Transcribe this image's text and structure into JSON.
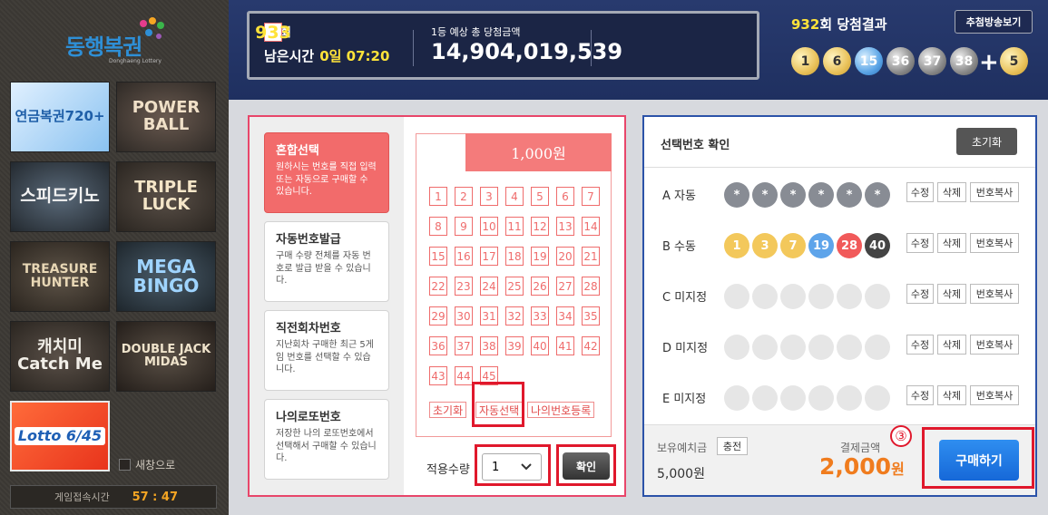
{
  "logo": {
    "text": "동행복권",
    "sub": "Donghaeng Lottery"
  },
  "games": [
    {
      "label": "연금복권720+",
      "icon": "pension-lottery-icon"
    },
    {
      "label": "POWER BALL",
      "icon": "powerball-icon"
    },
    {
      "label": "스피드키노",
      "icon": "speed-keno-icon"
    },
    {
      "label": "TRIPLE LUCK",
      "icon": "triple-luck-icon"
    },
    {
      "label": "TREASURE HUNTER",
      "icon": "treasure-hunter-icon"
    },
    {
      "label": "MEGA BINGO",
      "icon": "mega-bingo-icon"
    },
    {
      "label": "캐치미 Catch Me",
      "icon": "catch-me-icon"
    },
    {
      "label": "DOUBLE JACK MIDAS",
      "icon": "double-jack-icon"
    },
    {
      "label": "Lotto 6/45",
      "icon": "lotto645-icon"
    }
  ],
  "new_window": "새창으로",
  "session": {
    "label": "게임접속시간",
    "value": "57 : 47"
  },
  "draw": {
    "prefix": "제",
    "round": "933",
    "suffix": "회",
    "remain_label": "남은시간",
    "remain_value": "0일 07:20",
    "prize_label": "1등 예상 총 당첨금액",
    "prize_value": "14,904,019,539"
  },
  "result": {
    "round": "932",
    "label": "회 당첨결과",
    "broadcast": "추첨방송보기",
    "balls": [
      "1",
      "6",
      "15",
      "36",
      "37",
      "38"
    ],
    "bonus": "5",
    "plus": "+"
  },
  "modes": [
    {
      "title": "혼합선택",
      "desc": "원하시는 번호를 직접 입력 또는 자동으로 구매할 수 있습니다.",
      "active": true
    },
    {
      "title": "자동번호발급",
      "desc": "구매 수량 전체를 자동 번호로 발급 받을 수 있습니다."
    },
    {
      "title": "직전회차번호",
      "desc": "지난회차 구매한 최근 5게임 번호를 선택할 수 있습니다."
    },
    {
      "title": "나의로또번호",
      "desc": "저장한 나의 로또번호에서 선택해서 구매할 수 있습니다."
    }
  ],
  "grid": {
    "price": "1,000원",
    "numbers": [
      "1",
      "2",
      "3",
      "4",
      "5",
      "6",
      "7",
      "8",
      "9",
      "10",
      "11",
      "12",
      "13",
      "14",
      "15",
      "16",
      "17",
      "18",
      "19",
      "20",
      "21",
      "22",
      "23",
      "24",
      "25",
      "26",
      "27",
      "28",
      "29",
      "30",
      "31",
      "32",
      "33",
      "34",
      "35",
      "36",
      "37",
      "38",
      "39",
      "40",
      "41",
      "42",
      "43",
      "44",
      "45"
    ],
    "btn_reset": "초기화",
    "btn_auto": "자동선택",
    "btn_register": "나의번호등록"
  },
  "qty": {
    "label": "적용수량",
    "value": "1",
    "chevron": "chevron-down-icon"
  },
  "confirm": "확인",
  "selection": {
    "title": "선택번호 확인",
    "reset": "초기화",
    "rows": [
      {
        "label": "A 자동",
        "type": "star",
        "balls": [
          "*",
          "*",
          "*",
          "*",
          "*",
          "*"
        ]
      },
      {
        "label": "B 수동",
        "type": "manual",
        "balls": [
          "1",
          "3",
          "7",
          "19",
          "28",
          "40"
        ]
      },
      {
        "label": "C 미지정",
        "type": "empty",
        "balls": [
          "",
          "",
          "",
          "",
          "",
          ""
        ]
      },
      {
        "label": "D 미지정",
        "type": "empty",
        "balls": [
          "",
          "",
          "",
          "",
          "",
          ""
        ]
      },
      {
        "label": "E 미지정",
        "type": "empty",
        "balls": [
          "",
          "",
          "",
          "",
          "",
          ""
        ]
      }
    ],
    "btn_edit": "수정",
    "btn_delete": "삭제",
    "btn_copy": "번호복사"
  },
  "payment": {
    "balance_label": "보유예치금",
    "charge": "충전",
    "balance": "5,000원",
    "pay_label": "결제금액",
    "pay_value": "2,000",
    "pay_unit": "원",
    "buy": "구매하기",
    "step_marker": "③"
  }
}
